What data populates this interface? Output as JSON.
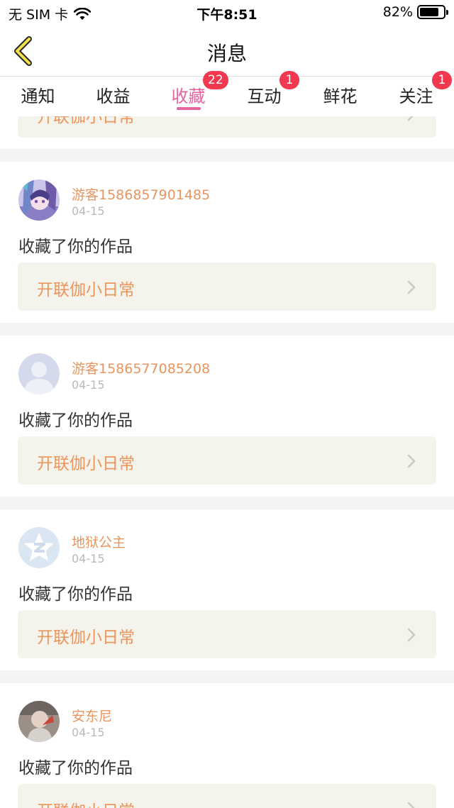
{
  "status_bar": {
    "carrier": "无 SIM 卡",
    "time": "下午8:51",
    "battery_percent": "82%",
    "battery_level": 0.82
  },
  "nav": {
    "title": "消息",
    "back_icon": "chevron-left-icon"
  },
  "tabs": [
    {
      "label": "通知",
      "badge": "",
      "active": false
    },
    {
      "label": "收益",
      "badge": "",
      "active": false
    },
    {
      "label": "收藏",
      "badge": "22",
      "active": true
    },
    {
      "label": "互动",
      "badge": "1",
      "active": false
    },
    {
      "label": "鲜花",
      "badge": "",
      "active": false
    },
    {
      "label": "关注",
      "badge": "1",
      "active": false
    }
  ],
  "partial_card": {
    "work_title": "开联伽小日常"
  },
  "cards": [
    {
      "username": "游客1586857901485",
      "date": "04-15",
      "action": "收藏了你的作品",
      "work_title": "开联伽小日常",
      "avatar": "anime-avatar"
    },
    {
      "username": "游客1586577085208",
      "date": "04-15",
      "action": "收藏了你的作品",
      "work_title": "开联伽小日常",
      "avatar": "default-person-avatar"
    },
    {
      "username": "地狱公主",
      "date": "04-15",
      "action": "收藏了你的作品",
      "work_title": "开联伽小日常",
      "avatar": "qq-logo-avatar"
    },
    {
      "username": "安东尼",
      "date": "04-15",
      "action": "收藏了你的作品",
      "work_title": "开联伽小日常",
      "avatar": "photo-avatar"
    }
  ],
  "colors": {
    "accent": "#e5649f",
    "badge": "#f2384f",
    "username": "#e8955f",
    "work_title": "#ec955b",
    "link_bg": "#f5f4ec"
  }
}
